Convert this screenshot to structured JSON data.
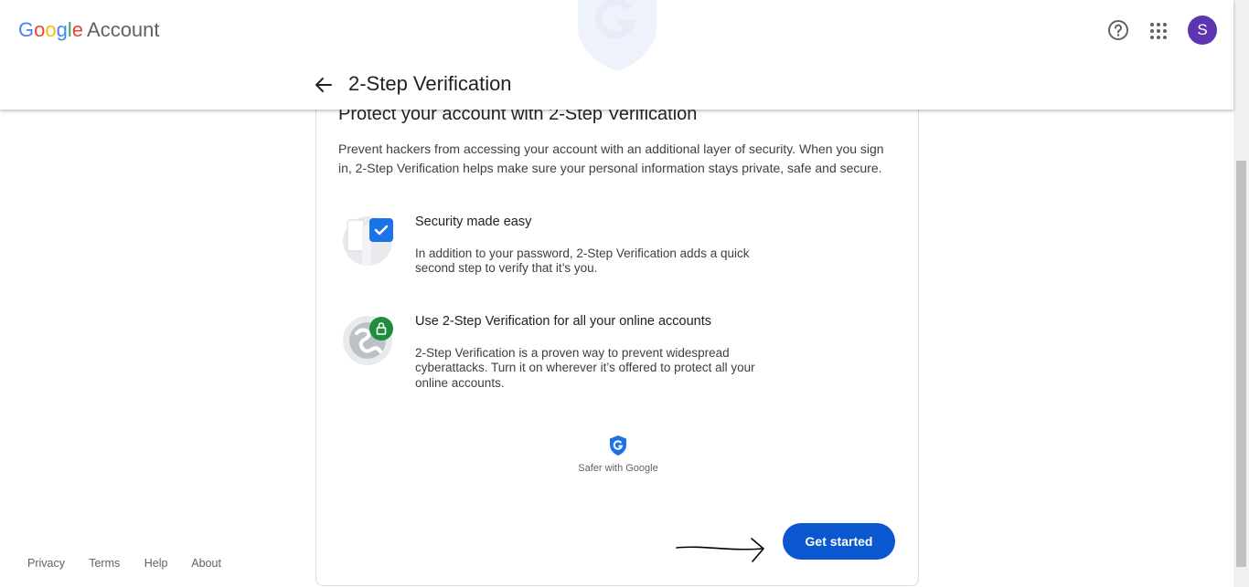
{
  "header": {
    "logo_google": [
      "G",
      "o",
      "o",
      "g",
      "l",
      "e"
    ],
    "logo_colors": [
      "#4285F4",
      "#EA4335",
      "#FBBC05",
      "#4285F4",
      "#34A853",
      "#EA4335"
    ],
    "logo_account": "Account",
    "help_icon": "help-circle-icon",
    "apps_icon": "apps-grid-icon",
    "avatar_letter": "S",
    "avatar_color": "#5e35b1"
  },
  "subheader": {
    "back_icon": "arrow-back-icon",
    "title": "2-Step Verification"
  },
  "card": {
    "title": "Protect your account with 2-Step Verification",
    "intro": "Prevent hackers from accessing your account with an additional layer of security. When you sign in, 2-Step Verification helps make sure your personal information stays private, safe and secure.",
    "features": [
      {
        "icon": "phone-checkmark-icon",
        "title": "Security made easy",
        "description": "In addition to your password, 2-Step Verification adds a quick second step to verify that it’s you."
      },
      {
        "icon": "globe-lock-icon",
        "title": "Use 2-Step Verification for all your online accounts",
        "description": "2-Step Verification is a proven way to prevent widespread cyberattacks. Turn it on wherever it’s offered to protect all your online accounts."
      }
    ],
    "safer_badge": {
      "icon": "google-shield-icon",
      "text": "Safer with Google"
    },
    "cta_label": "Get started",
    "cta_color": "#0b57d0"
  },
  "footer": {
    "links": [
      "Privacy",
      "Terms",
      "Help",
      "About"
    ]
  }
}
